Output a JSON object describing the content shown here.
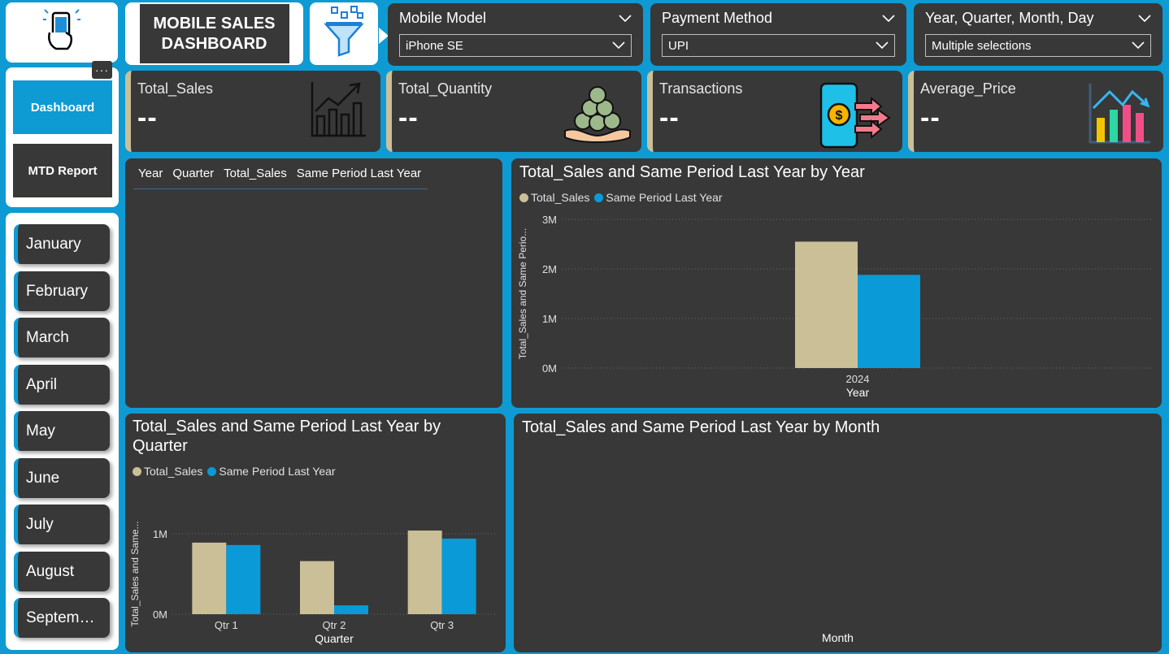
{
  "header": {
    "title": "MOBILE SALES\nDASHBOARD",
    "logo_icon": "phone-hand-icon",
    "filter_icon": "funnel-icon"
  },
  "slicers": [
    {
      "label": "Mobile Model",
      "value": "iPhone SE"
    },
    {
      "label": "Payment Method",
      "value": "UPI"
    },
    {
      "label": "Year, Quarter, Month, Day",
      "value": "Multiple selections"
    }
  ],
  "nav": {
    "more": "···",
    "dashboard": "Dashboard",
    "mtd_report": "MTD Report"
  },
  "months": [
    "January",
    "February",
    "March",
    "April",
    "May",
    "June",
    "July",
    "August",
    "Septem…"
  ],
  "kpis": [
    {
      "label": "Total_Sales",
      "value": "--",
      "icon": "growth-chart-icon"
    },
    {
      "label": "Total_Quantity",
      "value": "--",
      "icon": "coins-in-hand-icon"
    },
    {
      "label": "Transactions",
      "value": "--",
      "icon": "mobile-payment-icon"
    },
    {
      "label": "Average_Price",
      "value": "--",
      "icon": "bar-trend-icon"
    }
  ],
  "table": {
    "columns": [
      "Year",
      "Quarter",
      "Total_Sales",
      "Same Period Last Year"
    ]
  },
  "colors": {
    "background": "#0e9ad3",
    "panel": "#383838",
    "total_sales": "#cbbf98",
    "same_period": "#0a9ad7"
  },
  "chart_data": [
    {
      "type": "bar",
      "title": "Total_Sales and Same Period Last Year by Year",
      "categories": [
        "2024"
      ],
      "series": [
        {
          "name": "Total_Sales",
          "values": [
            2550000
          ]
        },
        {
          "name": "Same Period Last Year",
          "values": [
            1880000
          ]
        }
      ],
      "xlabel": "Year",
      "ylabel": "Total_Sales and Same Perio...",
      "yticks": [
        "0M",
        "1M",
        "2M",
        "3M"
      ],
      "ylim": [
        0,
        3000000
      ],
      "legend": "top-left",
      "grid": true
    },
    {
      "type": "bar",
      "title": "Total_Sales and Same Period Last Year by Quarter",
      "categories": [
        "Qtr 1",
        "Qtr 2",
        "Qtr 3"
      ],
      "series": [
        {
          "name": "Total_Sales",
          "values": [
            890000,
            660000,
            1040000
          ]
        },
        {
          "name": "Same Period Last Year",
          "values": [
            860000,
            110000,
            940000
          ]
        }
      ],
      "xlabel": "Quarter",
      "ylabel": "Total_Sales and Same...",
      "yticks": [
        "0M",
        "1M"
      ],
      "ylim": [
        0,
        1000000
      ],
      "legend": "top-left",
      "grid": true
    },
    {
      "type": "bar",
      "title": "Total_Sales and Same Period Last Year by Month",
      "categories": [],
      "series": [],
      "xlabel": "Month",
      "ylabel": ""
    }
  ]
}
